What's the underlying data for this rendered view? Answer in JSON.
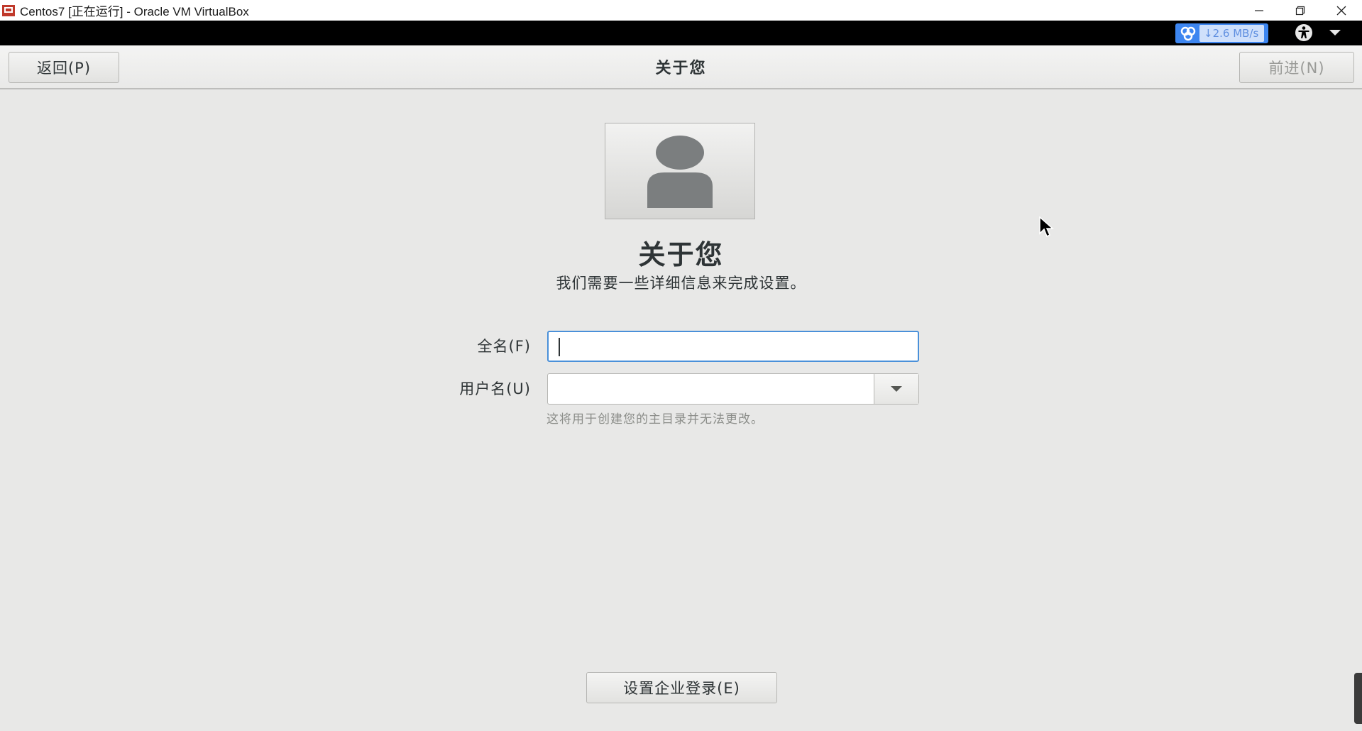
{
  "window": {
    "title": "Centos7 [正在运行] - Oracle VM VirtualBox",
    "icon": "virtualbox-icon",
    "controls": [
      "minimize-icon",
      "restore-icon",
      "close-icon"
    ]
  },
  "topbar": {
    "network_speed": "↓2.6 MB/s",
    "icons": [
      "network-activity-icon",
      "accessibility-icon",
      "chevron-down-icon"
    ],
    "accent": "#3d86f0"
  },
  "header": {
    "back_label": "返回(P)",
    "title": "关于您",
    "next_label": "前进(N)"
  },
  "main": {
    "avatar_icon": "user-avatar-icon",
    "title": "关于您",
    "subtitle": "我们需要一些详细信息来完成设置。",
    "fullname_label": "全名(F)",
    "fullname_value": "",
    "username_label": "用户名(U)",
    "username_value": "",
    "username_hint": "这将用于创建您的主目录并无法更改。",
    "enterprise_label": "设置企业登录(E)",
    "focus_color": "#4a90d9"
  }
}
